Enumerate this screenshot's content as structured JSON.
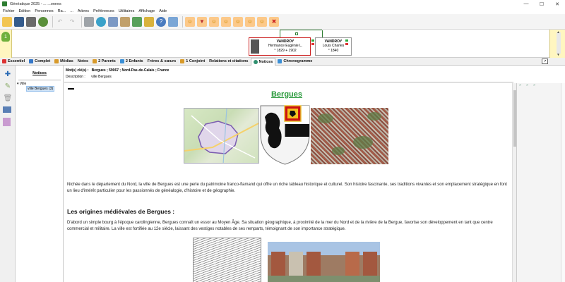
{
  "window": {
    "title": "Généatique 2025 - ... ...onnes",
    "minimize": "—",
    "maximize": "☐",
    "close": "✕"
  },
  "menu": [
    "Fichier",
    "Edition",
    "Personnes",
    "Ra...",
    "...",
    "Arbres",
    "Préférences",
    "Utilitaires",
    "Affichage",
    "Aide"
  ],
  "toolbar_icons": [
    "open-folder-icon",
    "save-icon",
    "print-icon",
    "sync-icon",
    "undo-icon",
    "redo-icon",
    "database-icon",
    "globe-icon",
    "grid-icon",
    "card-icon",
    "tree-icon",
    "network-icon",
    "help-icon",
    "chat-icon",
    "add-person-icon",
    "filter-icon",
    "person-add-icon",
    "person-link-icon",
    "couple-icon",
    "family-icon",
    "person-edit-icon",
    "person-delete-icon"
  ],
  "tree": {
    "badge": "1",
    "main_person": {
      "surname": "VANDROY",
      "firstname": "Hermance Eugénie L.",
      "dates": "° 1829   + 1902"
    },
    "father": {
      "surname": "VANDROY",
      "firstname": "Louis Charles",
      "dates": "° 1840"
    }
  },
  "tabs": [
    {
      "label": "Essentiel",
      "color": "#d33"
    },
    {
      "label": "Complet",
      "color": "#3577c8"
    },
    {
      "label": "Médias",
      "color": "#d89a2a"
    },
    {
      "label": "Notes",
      "color": "#888"
    },
    {
      "label": "2 Parents",
      "color": "#d89a2a"
    },
    {
      "label": "2 Enfants",
      "color": "#3a8fd6"
    },
    {
      "label": "Frères & sœurs",
      "color": ""
    },
    {
      "label": "1 Conjoint",
      "color": "#d89a2a"
    },
    {
      "label": "Relations et citations",
      "color": ""
    },
    {
      "label": "Notices",
      "color": "#2f8f6f"
    },
    {
      "label": "Chronogramme",
      "color": "#3a8fd6"
    }
  ],
  "list": {
    "header": "Notices",
    "root": "Ville",
    "child": "ville Bergues (3)"
  },
  "detail": {
    "keywords_label": "Mot(s) clé(s) :",
    "keywords": "Bergues ; 59067 ; Nord-Pas-de-Calais ; France",
    "description_label": "Description :",
    "description": "ville Bergues",
    "title": "Bergues",
    "intro": "Nichée dans le département du Nord, la ville de Bergues est une perle du patrimoine franco-flamand qui offre un riche tableau historique et culturel. Son histoire fascinante, ses traditions vivantes et son emplacement stratégique en font un lieu d'intérêt particulier pour les passionnés de généalogie, d'histoire et de géographie.",
    "section_title": "Les origines médiévales de Bergues :",
    "section_text": "D'abord un simple bourg à l'époque carolingienne, Bergues connaît un essor au Moyen Âge. Sa situation géographique, à proximité de la mer du Nord et de la rivière de la Bergue, favorise son développement en tant que centre commercial et militaire. La ville est fortifiée au 12e siècle, laissant des vestiges notables de ses remparts, témoignant de son importance stratégique."
  }
}
